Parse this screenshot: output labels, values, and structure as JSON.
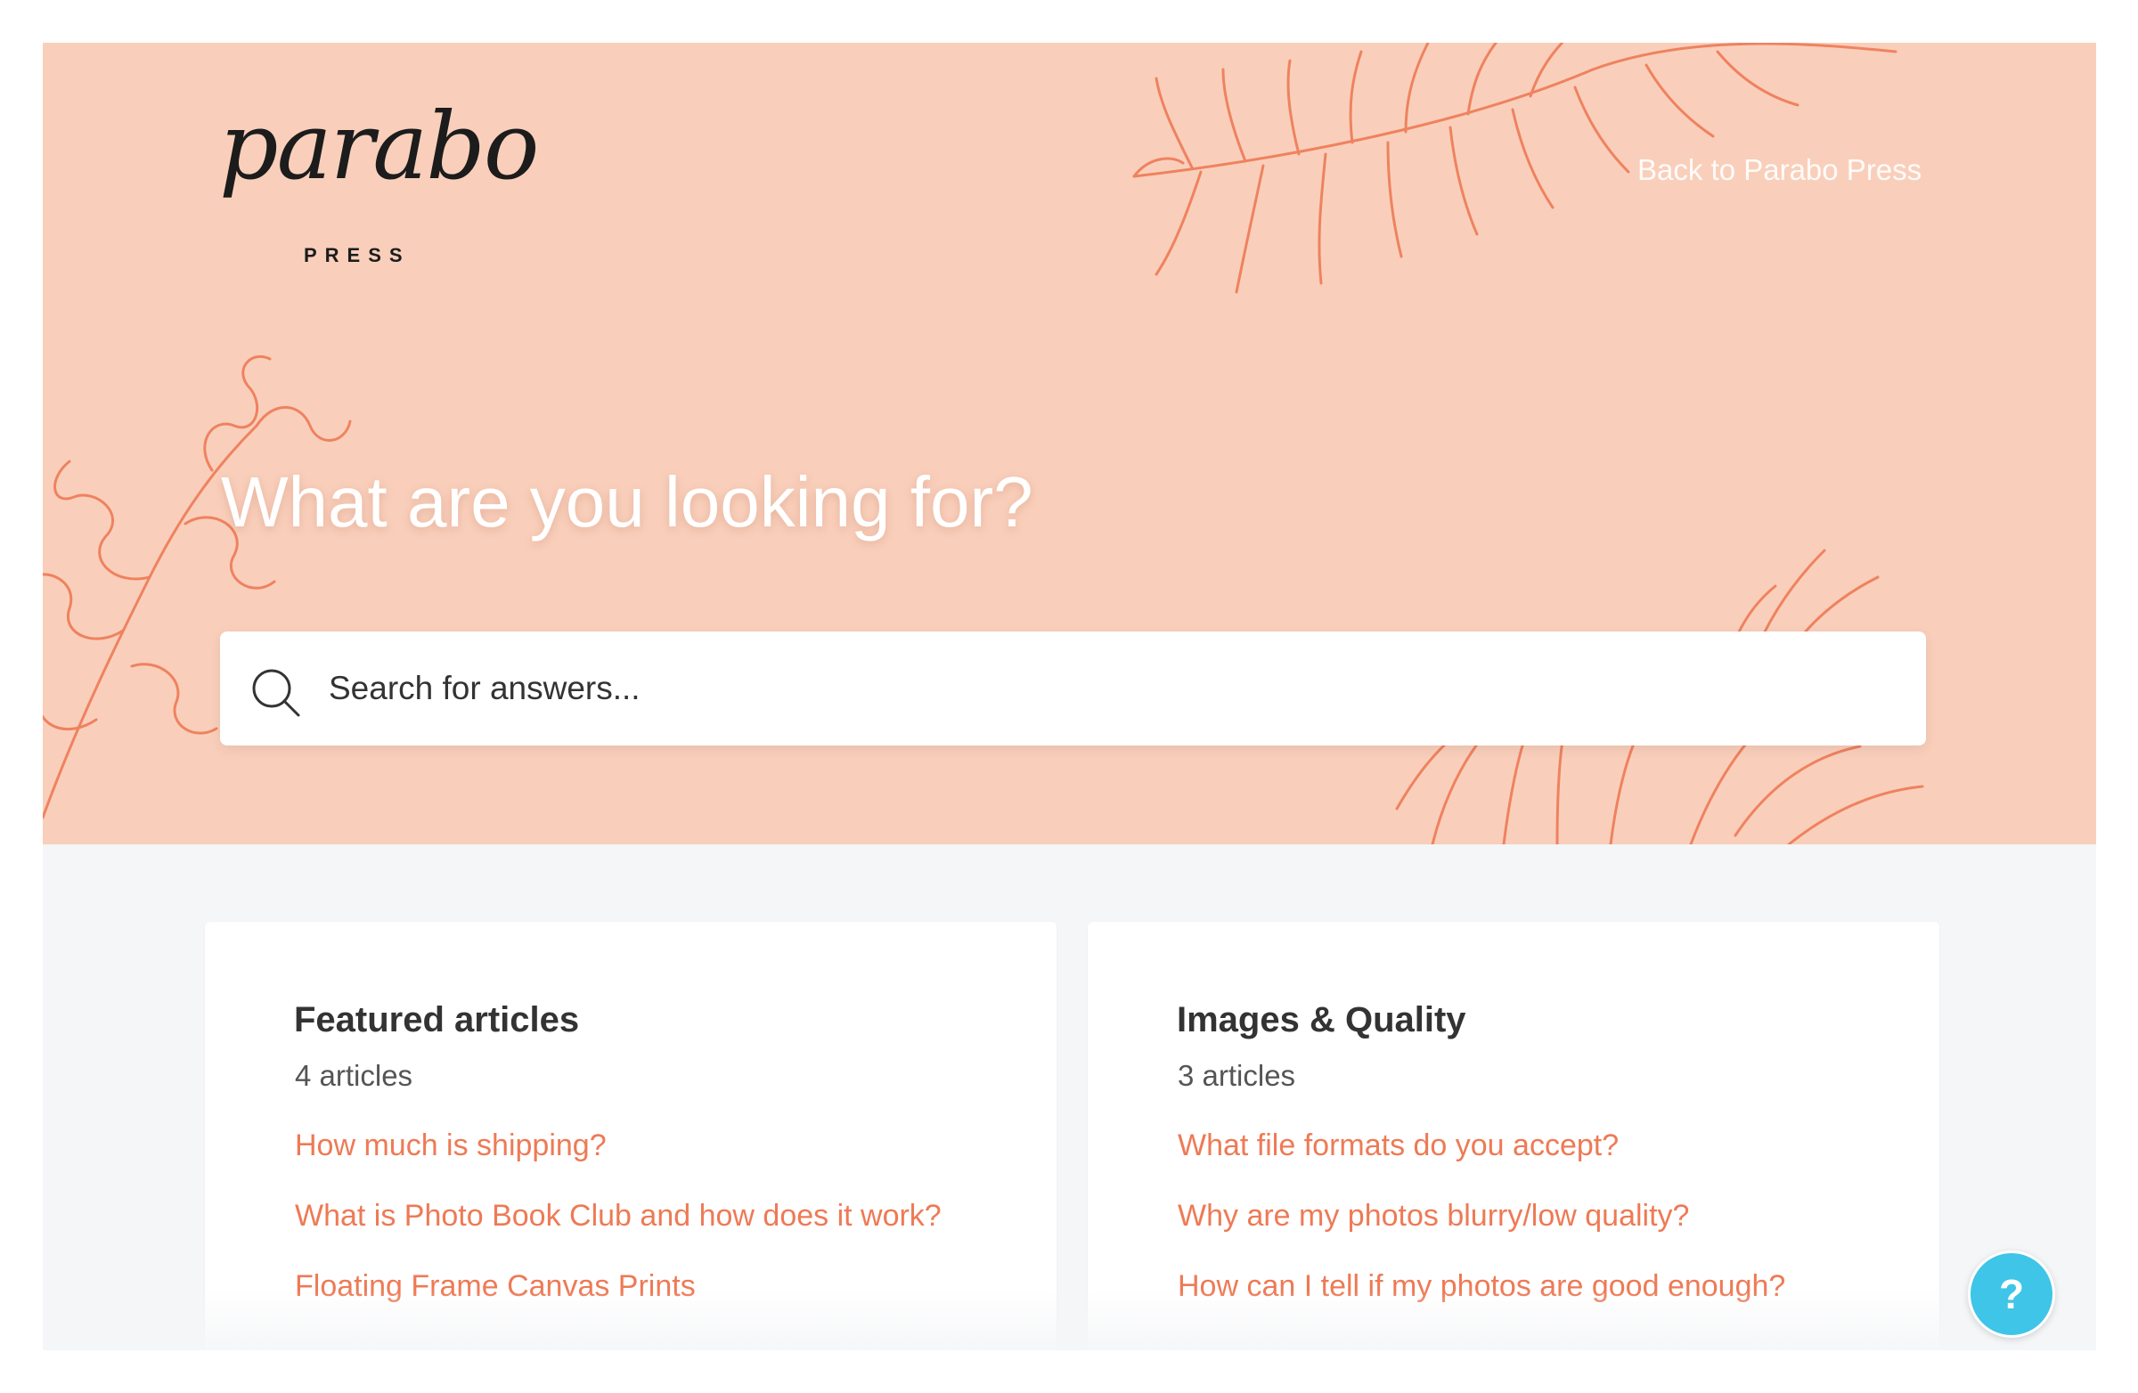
{
  "header": {
    "logo_script": "parabo",
    "logo_press": "PRESS",
    "back_link": "Back to Parabo Press"
  },
  "hero": {
    "heading": "What are you looking for?",
    "background_color": "#f9cfbb",
    "leaf_color": "#ee7550"
  },
  "search": {
    "placeholder": "Search for answers..."
  },
  "cards": [
    {
      "title": "Featured articles",
      "count": "4 articles",
      "links": [
        "How much is shipping?",
        "What is Photo Book Club and how does it work?",
        "Floating Frame Canvas Prints"
      ]
    },
    {
      "title": "Images & Quality",
      "count": "3 articles",
      "links": [
        "What file formats do you accept?",
        "Why are my photos blurry/low quality?",
        "How can I tell if my photos are good enough?"
      ]
    }
  ],
  "help": {
    "icon_label": "?",
    "color": "#3ec5e8"
  },
  "colors": {
    "link": "#ee7a55",
    "page_background": "#f5f6f8"
  }
}
